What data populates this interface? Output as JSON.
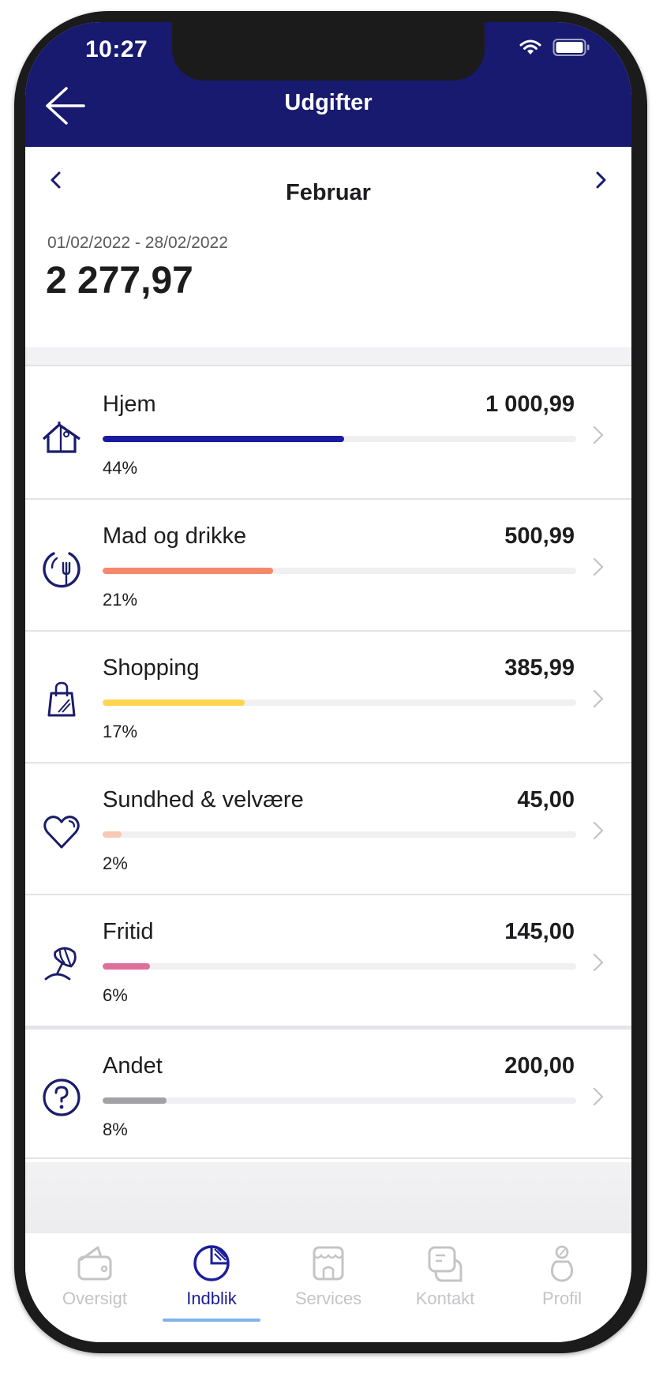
{
  "status_bar": {
    "time": "10:27",
    "icons": [
      "wifi-icon",
      "battery-icon"
    ]
  },
  "header": {
    "title": "Udgifter",
    "back_icon": "arrow-left-icon"
  },
  "period": {
    "month": "Februar",
    "prev_icon": "chevron-left-icon",
    "next_icon": "chevron-right-icon",
    "range": "01/02/2022 - 28/02/2022",
    "total": "2 277,97"
  },
  "colors": {
    "brand": "#171a6e",
    "icon": "#1a1d6b",
    "active_tab": "#1b1f9a",
    "tab_underline": "#7fb3ea",
    "inactive_tab": "#c4c4c7"
  },
  "categories": [
    {
      "name": "Hjem",
      "amount": "1 000,99",
      "percent_label": "44%",
      "bar_fraction": 0.51,
      "color": "#1a1ca0",
      "icon": "house-icon"
    },
    {
      "name": "Mad og drikke",
      "amount": "500,99",
      "percent_label": "21%",
      "bar_fraction": 0.36,
      "color": "#f4896a",
      "icon": "plate-fork-icon"
    },
    {
      "name": "Shopping",
      "amount": "385,99",
      "percent_label": "17%",
      "bar_fraction": 0.3,
      "color": "#ffd44f",
      "icon": "shopping-bag-icon"
    },
    {
      "name": "Sundhed & velvære",
      "amount": "45,00",
      "percent_label": "2%",
      "bar_fraction": 0.04,
      "color": "#f8c8b5",
      "icon": "heart-icon"
    },
    {
      "name": "Fritid",
      "amount": "145,00",
      "percent_label": "6%",
      "bar_fraction": 0.1,
      "color": "#de6f9b",
      "icon": "beach-umbrella-icon"
    },
    {
      "name": "Andet",
      "amount": "200,00",
      "percent_label": "8%",
      "bar_fraction": 0.135,
      "color": "#a2a2a5",
      "icon": "question-circle-icon"
    }
  ],
  "tabs": [
    {
      "label": "Oversigt",
      "icon": "wallet-icon",
      "active": false
    },
    {
      "label": "Indblik",
      "icon": "pie-chart-icon",
      "active": true
    },
    {
      "label": "Services",
      "icon": "store-icon",
      "active": false
    },
    {
      "label": "Kontakt",
      "icon": "chat-icon",
      "active": false
    },
    {
      "label": "Profil",
      "icon": "person-icon",
      "active": false
    }
  ]
}
